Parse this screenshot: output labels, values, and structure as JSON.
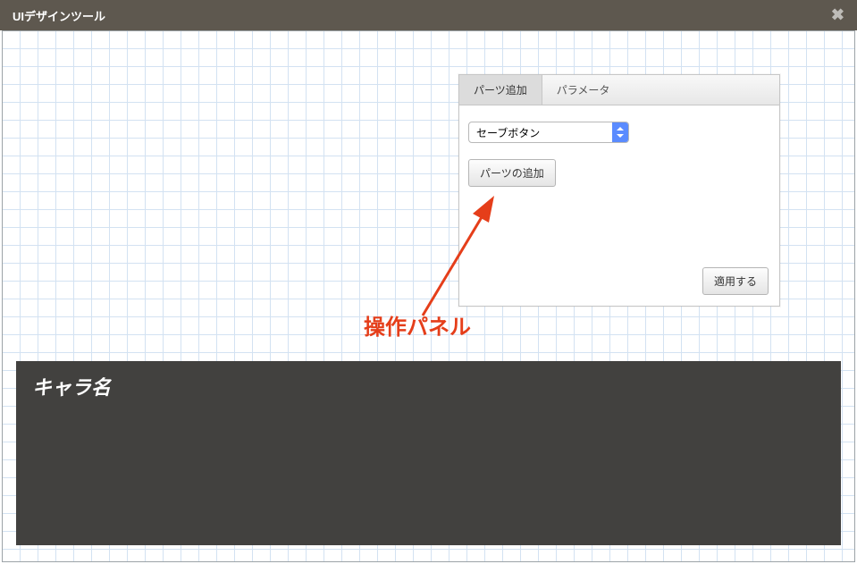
{
  "titlebar": {
    "title": "UIデザインツール",
    "close_glyph": "✖"
  },
  "panel": {
    "tabs": {
      "add_parts": "パーツ追加",
      "parameters": "パラメータ"
    },
    "select": {
      "value": "セーブボタン"
    },
    "add_button": "パーツの追加",
    "apply_button": "適用する"
  },
  "annotation": {
    "label": "操作パネル"
  },
  "dialog": {
    "name_label": "キャラ名"
  }
}
